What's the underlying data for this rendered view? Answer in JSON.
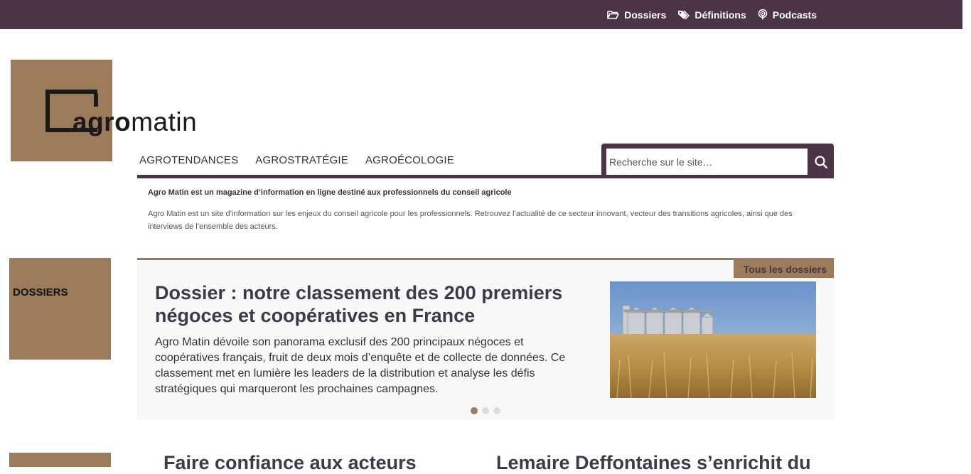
{
  "topbar": {
    "links": [
      {
        "label": "Dossiers",
        "icon": "folder-open-icon"
      },
      {
        "label": "Définitions",
        "icon": "tags-icon"
      },
      {
        "label": "Podcasts",
        "icon": "podcast-icon"
      }
    ]
  },
  "logo": {
    "bold": "agro",
    "regular": "matin"
  },
  "nav": {
    "items": [
      "AGROTENDANCES",
      "AGROSTRATÉGIE",
      "AGROÉCOLOGIE"
    ]
  },
  "search": {
    "placeholder": "Recherche sur le site…",
    "icon": "search-icon"
  },
  "intro": {
    "title": "Agro Matin est un magazine d’information en ligne destiné aux professionnels du conseil agricole",
    "description": "Agro Matin est un site d’information sur les enjeux du conseil agricole pour les professionnels. Retrouvez l’actualité de ce secteur innovant, vecteur des transitions agricoles, ainsi que des interviews de l’ensemble des acteurs."
  },
  "dossiers_section": {
    "label": "DOSSIERS",
    "all_link": "Tous les dossiers",
    "title": "Dossier : notre classement des 200 premiers négoces et coopératives en France",
    "text": "Agro Matin dévoile son panorama exclusif des 200 principaux négoces et coopératives français, fruit de deux mois d’enquête et de collecte de données. Ce classement met en lumière les leaders de la distribution et analyse les défis stratégiques qui marqueront les prochaines campagnes.",
    "carousel": {
      "count": 3,
      "active": 1
    }
  },
  "next_articles": [
    {
      "title": "Faire confiance aux acteurs"
    },
    {
      "title": "Lemaire Deffontaines s’enrichit du"
    }
  ],
  "colors": {
    "topbar": "#4a3446",
    "accent": "#9c7b5b",
    "panel": "#f8f8f8"
  }
}
